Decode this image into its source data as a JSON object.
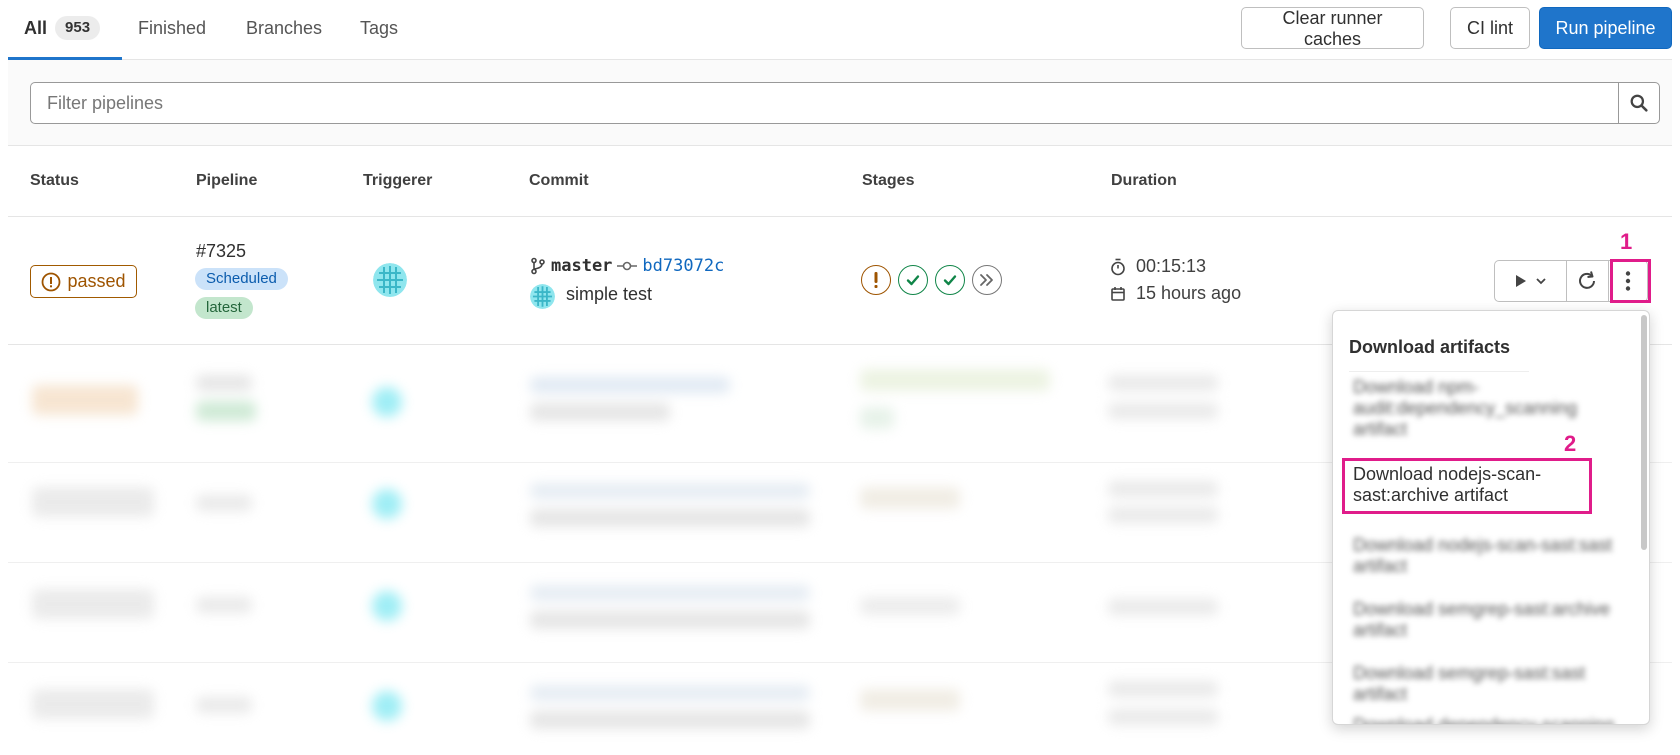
{
  "tabs": [
    {
      "label": "All",
      "count": "953"
    },
    {
      "label": "Finished"
    },
    {
      "label": "Branches"
    },
    {
      "label": "Tags"
    }
  ],
  "buttons": {
    "clear_caches": "Clear runner caches",
    "ci_lint": "CI lint",
    "run_pipeline": "Run pipeline"
  },
  "filter": {
    "placeholder": "Filter pipelines"
  },
  "columns": [
    "Status",
    "Pipeline",
    "Triggerer",
    "Commit",
    "Stages",
    "Duration"
  ],
  "row": {
    "status": "passed",
    "pipeline_id": "#7325",
    "badges": [
      "Scheduled",
      "latest"
    ],
    "branch": "master",
    "sha": "bd73072c",
    "commit_title": "simple test",
    "stages": [
      "warning",
      "success",
      "success",
      "skipped"
    ],
    "duration": "00:15:13",
    "finished": "15 hours ago"
  },
  "annotations": {
    "one": "1",
    "two": "2"
  },
  "dropdown": {
    "header": "Download artifacts",
    "items": [
      "Download npm-audit:dependency_scanning artifact",
      "Download nodejs-scan-sast:archive artifact",
      "Download nodejs-scan-sast:sast artifact",
      "Download semgrep-sast:archive artifact",
      "Download semgrep-sast:sast artifact",
      "Download dependency-scanning artifact"
    ]
  },
  "colors": {
    "accent": "#1f75cb",
    "highlight": "#e01c8a",
    "warning": "#9e5400",
    "success": "#108548"
  }
}
